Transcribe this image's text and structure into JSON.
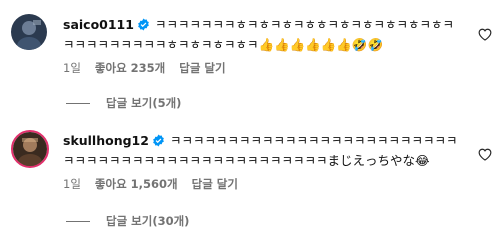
{
  "comments": [
    {
      "username": "saico0111",
      "text": "ㅋㅋㅋㅋㅋㅋㅋㅎㅋㅎㅋㅎㅋㅎㅎㅋㅎㅋㅎㅋㅎㅋㅎㅋㅎㅋㅋㅋㅋㅋㅋㅋㅋㅋㅋㅎㅋㅎㅋㅎㅋㅎㅋ👍👍👍👍👍👍🤣🤣",
      "time": "1일",
      "likes": "좋아요 235개",
      "reply": "답글 달기",
      "view_replies": "답글 보기(5개)"
    },
    {
      "username": "skullhong12",
      "text": "ㅋㅋㅋㅋㅋㅋㅋㅋㅋㅋㅋㅋㅋㅋㅋㅋㅋㅋㅋㅋㅋㅋㅋㅋㅋㅋㅋㅋㅋㅋㅋㅋㅋㅋㅋㅋㅋㅋㅋㅋㅋㅋㅋㅋㅋㅋㅋㅋまじえっちやな😂",
      "time": "1일",
      "likes": "좋아요 1,560개",
      "reply": "답글 달기",
      "view_replies": "답글 보기(30개)"
    }
  ],
  "colors": {
    "verified": "#0095f6",
    "meta": "#737373"
  }
}
